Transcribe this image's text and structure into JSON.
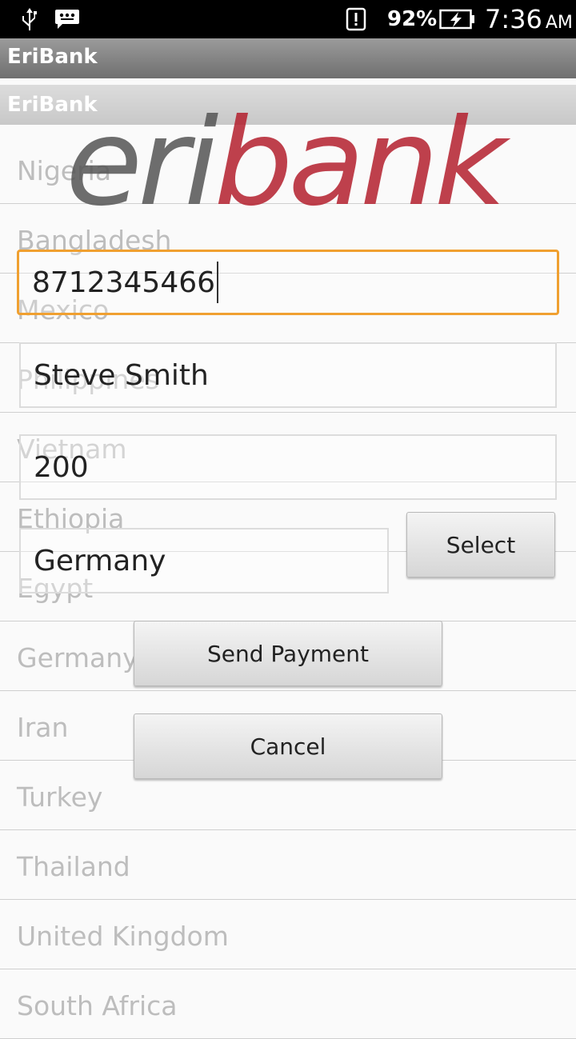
{
  "status_bar": {
    "battery_percent": "92%",
    "time": "7:36",
    "ampm": "AM",
    "icons": [
      "usb-icon",
      "chat-notification-icon",
      "alert-icon",
      "battery-charging-icon"
    ]
  },
  "action_bar": {
    "title": "EriBank"
  },
  "sub_bar": {
    "title": "EriBank"
  },
  "logo": {
    "part1": "eri",
    "part2": "bank",
    "color1": "#555555",
    "color2": "#b4202e"
  },
  "countries": [
    "Nigeria",
    "Bangladesh",
    "Mexico",
    "Philippines",
    "Vietnam",
    "Ethiopia",
    "Egypt",
    "Germany",
    "Iran",
    "Turkey",
    "Thailand",
    "United Kingdom",
    "South Africa"
  ],
  "form": {
    "phone_value": "8712345466",
    "name_value": "Steve Smith",
    "amount_value": "200",
    "country_value": "Germany",
    "select_label": "Select",
    "send_label": "Send Payment",
    "cancel_label": "Cancel"
  }
}
